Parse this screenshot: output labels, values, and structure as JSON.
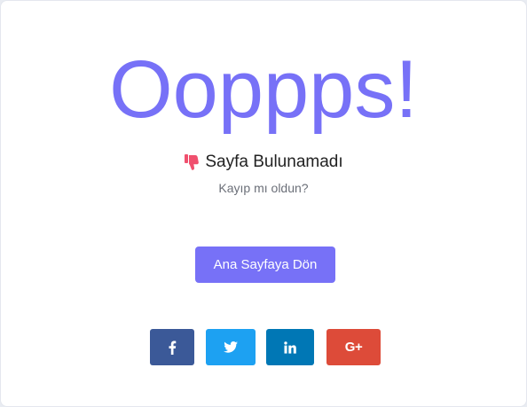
{
  "error": {
    "headline": "Ooppps!",
    "subtitle": "Sayfa Bulunamadı",
    "question": "Kayıp mı oldun?"
  },
  "actions": {
    "home_label": "Ana Sayfaya Dön"
  },
  "social": [
    {
      "name": "facebook",
      "icon": "facebook-icon",
      "color": "#3b5998"
    },
    {
      "name": "twitter",
      "icon": "twitter-icon",
      "color": "#1da1f2"
    },
    {
      "name": "linkedin",
      "icon": "linkedin-icon",
      "color": "#0077b5"
    },
    {
      "name": "google-plus",
      "icon": "google-plus-icon",
      "label": "G+",
      "color": "#dd4b39"
    }
  ],
  "colors": {
    "accent": "#7771f7",
    "thumb": "#f0506e"
  }
}
